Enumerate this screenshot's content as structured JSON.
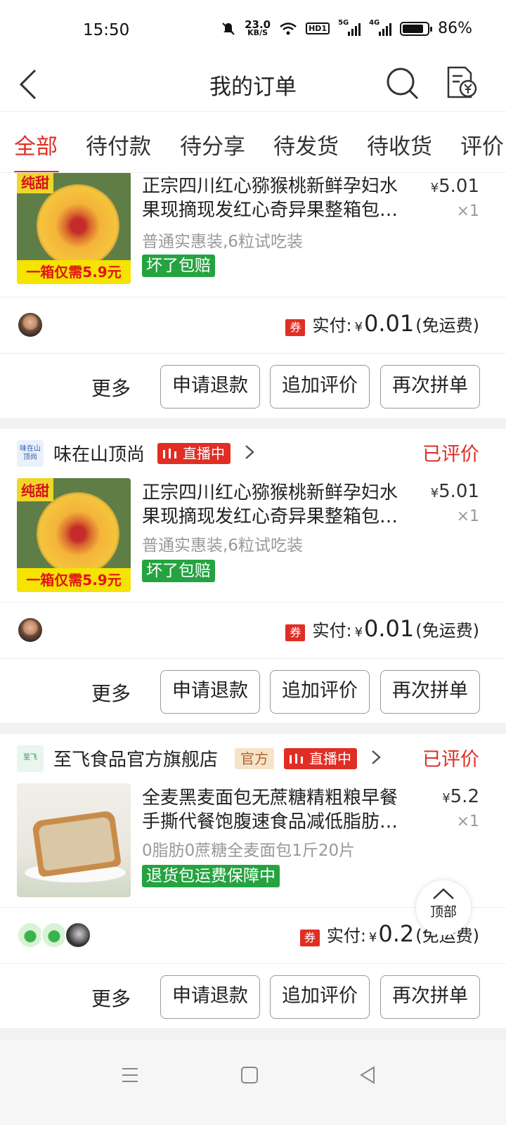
{
  "status_bar": {
    "time": "15:50",
    "net_speed_value": "23.0",
    "net_speed_unit": "KB/S",
    "hd_label": "HD1",
    "sig1_label": "5G",
    "sig2_label": "4G",
    "battery_percent": "86%",
    "battery_level": 0.86
  },
  "header": {
    "title": "我的订单"
  },
  "tabs": [
    {
      "label": "全部",
      "active": true
    },
    {
      "label": "待付款"
    },
    {
      "label": "待分享"
    },
    {
      "label": "待发货"
    },
    {
      "label": "待收货"
    },
    {
      "label": "评价"
    }
  ],
  "orders": [
    {
      "product": {
        "title_line1": "正宗四川红心猕猴桃新鲜孕妇水",
        "title_line2": "果现摘现发红心奇异果整箱包…",
        "price_symbol": "¥",
        "price": "5.01",
        "qty": "×1",
        "spec": "普通实惠装,6粒试吃装",
        "badge": "坏了包赔",
        "thumb_label": "纯甜",
        "thumb_banner": "一箱仅需5.9元"
      },
      "pay": {
        "coupon": "券",
        "label": "实付:",
        "symbol": "¥",
        "amount": "0.01",
        "note": "(免运费)"
      },
      "actions": {
        "more": "更多",
        "refund": "申请退款",
        "review": "追加评价",
        "reorder": "再次拼单"
      }
    },
    {
      "shop": {
        "logo_text": "味在山顶尚",
        "name": "味在山顶尚",
        "live": "直播中"
      },
      "status": "已评价",
      "product": {
        "title_line1": "正宗四川红心猕猴桃新鲜孕妇水",
        "title_line2": "果现摘现发红心奇异果整箱包…",
        "price_symbol": "¥",
        "price": "5.01",
        "qty": "×1",
        "spec": "普通实惠装,6粒试吃装",
        "badge": "坏了包赔",
        "thumb_label": "纯甜",
        "thumb_banner": "一箱仅需5.9元"
      },
      "pay": {
        "coupon": "券",
        "label": "实付:",
        "symbol": "¥",
        "amount": "0.01",
        "note": "(免运费)"
      },
      "actions": {
        "more": "更多",
        "refund": "申请退款",
        "review": "追加评价",
        "reorder": "再次拼单"
      }
    },
    {
      "shop": {
        "logo_text": "至飞",
        "name": "至飞食品官方旗舰店",
        "official": "官方",
        "live": "直播中"
      },
      "status": "已评价",
      "product": {
        "title_line1": "全麦黑麦面包无蔗糖精粗粮早餐",
        "title_line2": "手撕代餐饱腹速食品减低脂肪…",
        "price_symbol": "¥",
        "price": "5.2",
        "qty": "×1",
        "spec": "0脂肪0蔗糖全麦面包1斤20片",
        "badge": "退货包运费保障中"
      },
      "pay": {
        "coupon": "券",
        "label": "实付:",
        "symbol": "¥",
        "amount": "0.2",
        "note": "(免运费)"
      },
      "actions": {
        "more": "更多",
        "refund": "申请退款",
        "review": "追加评价",
        "reorder": "再次拼单"
      }
    }
  ],
  "top_button": {
    "label": "顶部"
  },
  "colors": {
    "accent": "#e02e24",
    "badge_green": "#25a340",
    "official_tag": "#f6e3c8"
  }
}
